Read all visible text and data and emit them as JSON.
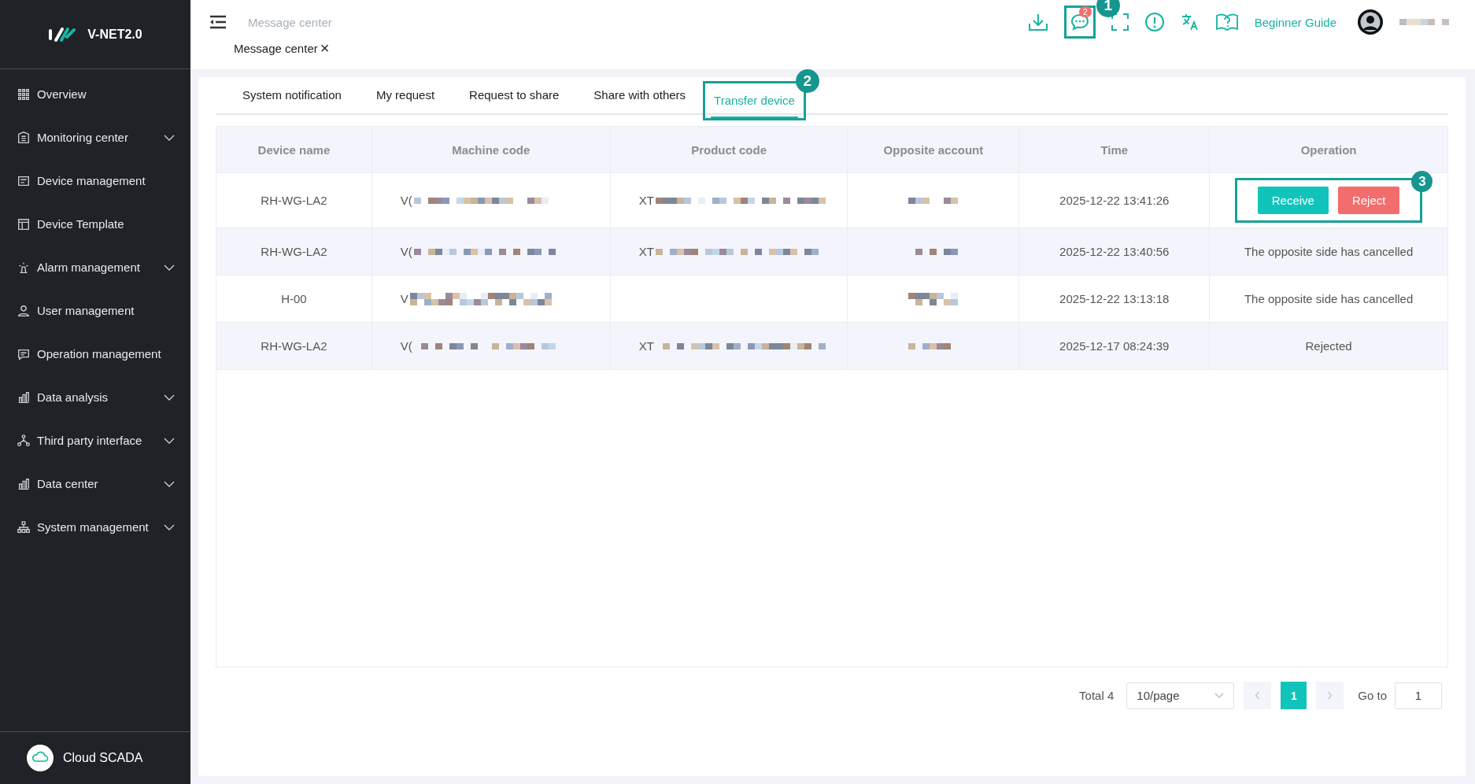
{
  "sidebar": {
    "logo": "V-NET2.0",
    "items": [
      {
        "label": "Overview",
        "expandable": false
      },
      {
        "label": "Monitoring center",
        "expandable": true
      },
      {
        "label": "Device management",
        "expandable": false
      },
      {
        "label": "Device Template",
        "expandable": false
      },
      {
        "label": "Alarm management",
        "expandable": true
      },
      {
        "label": "User management",
        "expandable": false
      },
      {
        "label": "Operation management",
        "expandable": false
      },
      {
        "label": "Data analysis",
        "expandable": true
      },
      {
        "label": "Third party interface",
        "expandable": true
      },
      {
        "label": "Data center",
        "expandable": true
      },
      {
        "label": "System management",
        "expandable": true
      }
    ],
    "footer": "Cloud SCADA"
  },
  "header": {
    "breadcrumb": "Message center",
    "tag": "Message center",
    "close": "×",
    "chat_badge": "2",
    "chat_annotation": "1",
    "guide": "Beginner Guide"
  },
  "tabs": [
    {
      "label": "System notification",
      "selected": false
    },
    {
      "label": "My request",
      "selected": false
    },
    {
      "label": "Request to share",
      "selected": false
    },
    {
      "label": "Share with others",
      "selected": false
    },
    {
      "label": "Transfer device",
      "selected": true,
      "annotation": "2"
    }
  ],
  "table": {
    "columns": [
      "Device name",
      "Machine code",
      "Product code",
      "Opposite account",
      "Time",
      "Operation"
    ],
    "rows": [
      {
        "device_name": "RH-WG-LA2",
        "machine_code": "V(",
        "product_code": "XT",
        "time": "2025-12-22 13:41:26",
        "operation": {
          "kind": "buttons",
          "buttons": [
            "Receive",
            "Reject"
          ],
          "annotation": "3"
        }
      },
      {
        "device_name": "RH-WG-LA2",
        "machine_code": "V(",
        "product_code": "XT",
        "time": "2025-12-22 13:40:56",
        "operation": {
          "kind": "text",
          "text": "The opposite side has cancelled"
        }
      },
      {
        "device_name": "H-00",
        "machine_code": "V",
        "time": "2025-12-22 13:13:18",
        "operation": {
          "kind": "text",
          "text": "The opposite side has cancelled"
        }
      },
      {
        "device_name": "RH-WG-LA2",
        "machine_code": "V(",
        "product_code": "XT",
        "time": "2025-12-17 08:24:39",
        "operation": {
          "kind": "text",
          "text": "Rejected"
        }
      }
    ]
  },
  "pagination": {
    "total": "Total 4",
    "page_size": "10/page",
    "pages": [
      {
        "label": "1",
        "selected": true
      }
    ],
    "goto_label": "Go to",
    "goto_value": "1"
  }
}
